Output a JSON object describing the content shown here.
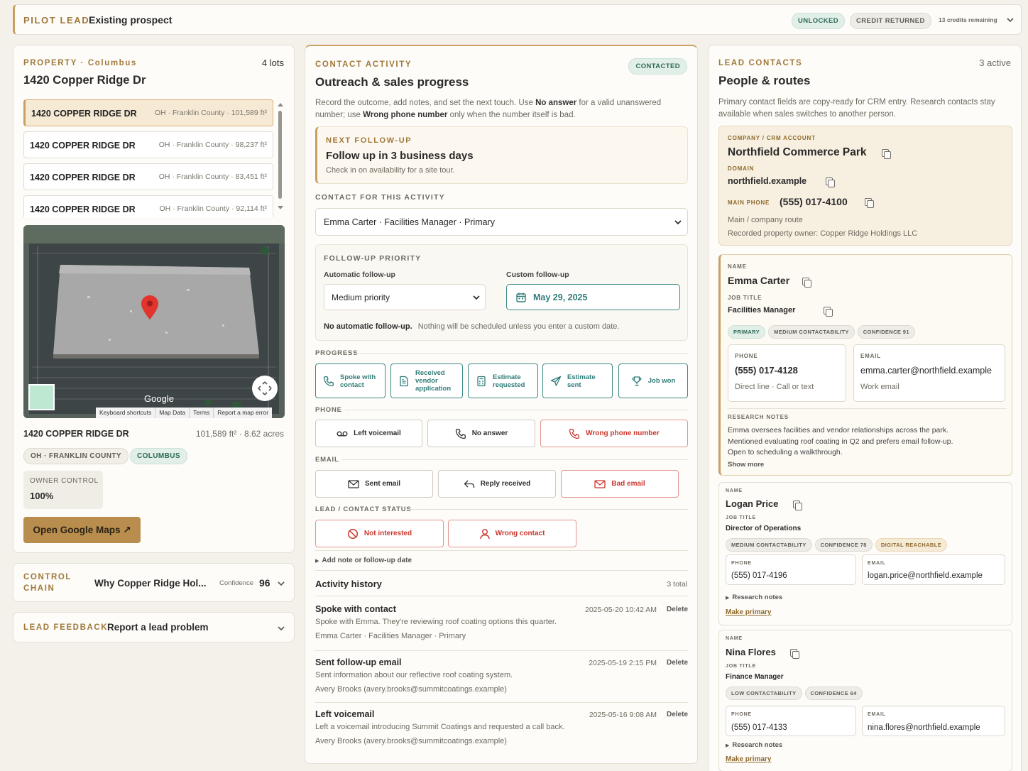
{
  "topbar": {
    "label": "PILOT LEAD",
    "title": "Existing prospect",
    "badge_unlocked": "UNLOCKED",
    "badge_credit": "CREDIT RETURNED",
    "credits": "13 credits remaining"
  },
  "property": {
    "eyebrow": "PROPERTY · Columbus",
    "lots_count": "4 lots",
    "address": "1420 Copper Ridge Dr",
    "lots": [
      {
        "name": "1420 COPPER RIDGE DR",
        "meta": "OH · Franklin County · 101,589 ft²"
      },
      {
        "name": "1420 COPPER RIDGE DR",
        "meta": "OH · Franklin County · 98,237 ft²"
      },
      {
        "name": "1420 COPPER RIDGE DR",
        "meta": "OH · Franklin County · 83,451 ft²"
      },
      {
        "name": "1420 COPPER RIDGE DR",
        "meta": "OH · Franklin County · 92,114 ft²"
      }
    ],
    "map": {
      "brand": "Google",
      "links": [
        "Keyboard shortcuts",
        "Map Data",
        "Terms",
        "Report a map error"
      ]
    },
    "selected_name": "1420 COPPER RIDGE DR",
    "selected_meta": "101,589 ft² · 8.62 acres",
    "tags": [
      "OH · FRANKLIN COUNTY",
      "COLUMBUS"
    ],
    "owner_label": "OWNER CONTROL",
    "owner_value": "100%",
    "maps_button": "Open Google Maps ↗"
  },
  "control_chain": {
    "label_1": "CONTROL",
    "label_2": "CHAIN",
    "title": "Why Copper Ridge Hol...",
    "confidence_label": "Confidence",
    "confidence_value": "96"
  },
  "feedback": {
    "label": "LEAD FEEDBACK",
    "title": "Report a lead problem"
  },
  "activity": {
    "eyebrow": "CONTACT ACTIVITY",
    "badge": "CONTACTED",
    "title": "Outreach & sales progress",
    "desc_1a": "Record the outcome, add notes, and set the next touch. Use ",
    "desc_1b": "No answer",
    "desc_1c": " for a valid unanswered",
    "desc_2a": "number; use ",
    "desc_2b": "Wrong phone number",
    "desc_2c": " only when the number itself is bad.",
    "next_label": "NEXT FOLLOW-UP",
    "next_title": "Follow up in 3 business days",
    "next_desc": "Check in on availability for a site tour.",
    "contact_label": "CONTACT FOR THIS ACTIVITY",
    "contact_value": "Emma Carter · Facilities Manager · Primary",
    "priority_label": "FOLLOW-UP PRIORITY",
    "auto_label": "Automatic follow-up",
    "auto_value": "Medium priority",
    "custom_label": "Custom follow-up",
    "custom_value": "May 29, 2025",
    "no_auto_b": "No automatic follow-up.",
    "no_auto_t": "Nothing will be scheduled unless you enter a custom date.",
    "progress_label": "PROGRESS",
    "progress": [
      {
        "l1": "Spoke with",
        "l2": "contact",
        "l3": ""
      },
      {
        "l1": "Received",
        "l2": "vendor",
        "l3": "application"
      },
      {
        "l1": "Estimate",
        "l2": "requested",
        "l3": ""
      },
      {
        "l1": "Estimate",
        "l2": "sent",
        "l3": ""
      },
      {
        "l1": "Job won",
        "l2": "",
        "l3": ""
      }
    ],
    "phone_label": "PHONE",
    "phone_btns": [
      "Left voicemail",
      "No answer",
      "Wrong phone number"
    ],
    "email_label": "EMAIL",
    "email_btns": [
      "Sent email",
      "Reply received",
      "Bad email"
    ],
    "status_label": "LEAD / CONTACT STATUS",
    "status_btns": [
      "Not interested",
      "Wrong contact"
    ],
    "add_note": "Add note or follow-up date",
    "history_title": "Activity history",
    "history_count": "3 total",
    "delete": "Delete",
    "history": [
      {
        "title": "Spoke with contact",
        "time": "2025-05-20 10:42 AM",
        "note": "Spoke with Emma. They're reviewing roof coating options this quarter.",
        "who": "Emma Carter · Facilities Manager · Primary"
      },
      {
        "title": "Sent follow-up email",
        "time": "2025-05-19 2:15 PM",
        "note": "Sent information about our reflective roof coating system.",
        "who": "Avery Brooks (avery.brooks@summitcoatings.example)"
      },
      {
        "title": "Left voicemail",
        "time": "2025-05-16 9:08 AM",
        "note": "Left a voicemail introducing Summit Coatings and requested a call back.",
        "who": "Avery Brooks (avery.brooks@summitcoatings.example)"
      }
    ]
  },
  "contacts": {
    "eyebrow": "LEAD CONTACTS",
    "count": "3 active",
    "title": "People & routes",
    "desc_1": "Primary contact fields are copy-ready for CRM entry. Research contacts stay",
    "desc_2": "available when sales switches to another person.",
    "company": {
      "label": "COMPANY / CRM ACCOUNT",
      "name": "Northfield Commerce Park",
      "domain_label": "DOMAIN",
      "domain": "northfield.example",
      "phone_label": "MAIN PHONE",
      "phone": "(555) 017-4100",
      "route": "Main / company route",
      "owner": "Recorded property owner: Copper Ridge Holdings LLC"
    },
    "primary": {
      "name_label": "NAME",
      "name": "Emma Carter",
      "job_label": "JOB TITLE",
      "job": "Facilities Manager",
      "tags": [
        "PRIMARY",
        "MEDIUM CONTACTABILITY",
        "CONFIDENCE 91"
      ],
      "phone_label": "PHONE",
      "phone": "(555) 017-4128",
      "phone_note": "Direct line · Call or text",
      "email_label": "EMAIL",
      "email": "emma.carter@northfield.example",
      "email_note": "Work email",
      "notes_label": "RESEARCH NOTES",
      "notes_1": "Emma oversees facilities and vendor relationships across the park.",
      "notes_2": "Mentioned evaluating roof coating in Q2 and prefers email follow-up.",
      "notes_3": "Open to scheduling a walkthrough.",
      "show_more": "Show more"
    },
    "others": [
      {
        "name_label": "NAME",
        "name": "Logan Price",
        "job_label": "JOB TITLE",
        "job": "Director of Operations",
        "tags": [
          "MEDIUM CONTACTABILITY",
          "CONFIDENCE 78",
          "DIGITAL REACHABLE"
        ],
        "phone_label": "PHONE",
        "phone": "(555) 017-4196",
        "email_label": "EMAIL",
        "email": "logan.price@northfield.example",
        "notes": "Research notes",
        "make_primary": "Make primary"
      },
      {
        "name_label": "NAME",
        "name": "Nina Flores",
        "job_label": "JOB TITLE",
        "job": "Finance Manager",
        "tags": [
          "LOW CONTACTABILITY",
          "CONFIDENCE 64"
        ],
        "phone_label": "PHONE",
        "phone": "(555) 017-4133",
        "email_label": "EMAIL",
        "email": "nina.flores@northfield.example",
        "notes": "Research notes",
        "make_primary": "Make primary"
      }
    ]
  }
}
